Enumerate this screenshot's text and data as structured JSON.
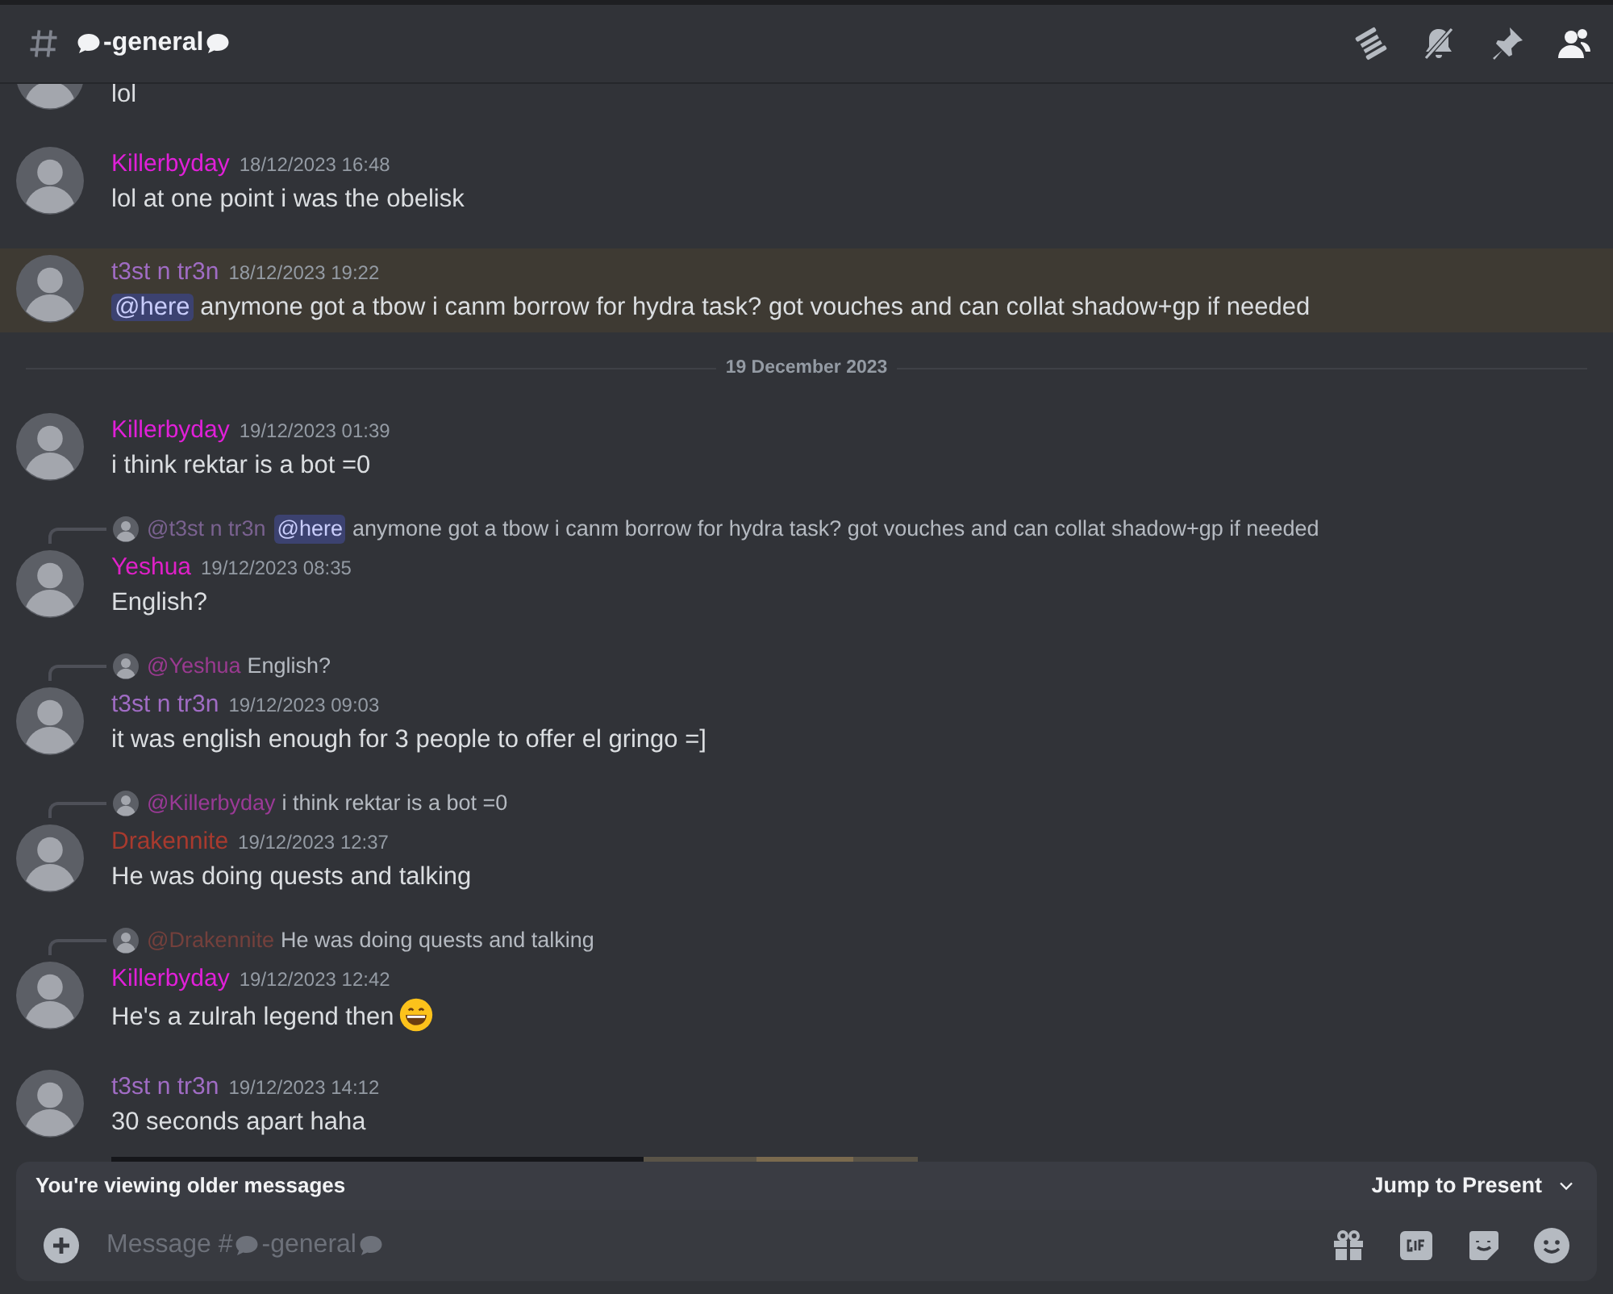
{
  "channel": {
    "name": "-general"
  },
  "feed": [
    {
      "kind": "message",
      "text": "lol"
    },
    {
      "kind": "message",
      "author": "Killerbyday",
      "color": "#e020d8",
      "time": "18/12/2023 16:48",
      "text": "lol at one point i was the obelisk"
    },
    {
      "kind": "message",
      "author": "t3st n tr3n",
      "color": "#a06cc4",
      "time": "18/12/2023 19:22",
      "highlighted": true,
      "mention": "@here",
      "text": "anymone got a tbow i canm borrow for hydra task? got vouches and can collat shadow+gp if needed"
    },
    {
      "kind": "divider",
      "text": "19 December 2023"
    },
    {
      "kind": "message",
      "author": "Killerbyday",
      "color": "#e020d8",
      "time": "19/12/2023 01:39",
      "text": "i think rektar is a bot =0"
    },
    {
      "kind": "message",
      "author": "Yeshua",
      "color": "#e020c8",
      "time": "19/12/2023 08:35",
      "text": "English?",
      "reply": {
        "author": "@t3st n tr3n",
        "color": "#7a6290",
        "mention": "@here",
        "text": "anymone got a tbow i canm borrow for hydra task? got vouches and can collat shadow+gp if needed"
      }
    },
    {
      "kind": "message",
      "author": "t3st n tr3n",
      "color": "#a06cc4",
      "time": "19/12/2023 09:03",
      "text": "it was english enough for 3 people to offer el gringo =]",
      "reply": {
        "author": "@Yeshua",
        "color": "#9a3a90",
        "text": "English?"
      }
    },
    {
      "kind": "message",
      "author": "Drakennite",
      "color": "#a83a2e",
      "time": "19/12/2023 12:37",
      "text": "He was doing quests and talking",
      "reply": {
        "author": "@Killerbyday",
        "color": "#9a3a96",
        "text": "i think rektar is a bot =0"
      }
    },
    {
      "kind": "message",
      "author": "Killerbyday",
      "color": "#e020d8",
      "time": "19/12/2023 12:42",
      "text": "He's a zulrah legend then",
      "emoji": true,
      "reply": {
        "author": "@Drakennite",
        "color": "#74403c",
        "text": "He was doing quests and talking"
      }
    },
    {
      "kind": "message",
      "author": "t3st n tr3n",
      "color": "#a06cc4",
      "time": "19/12/2023 14:12",
      "text": "30 seconds apart haha",
      "attachment": true
    }
  ],
  "notice": {
    "text": "You're viewing older messages",
    "action": "Jump to Present"
  },
  "composer": {
    "placeholder": "Message #",
    "channel": "-general"
  }
}
